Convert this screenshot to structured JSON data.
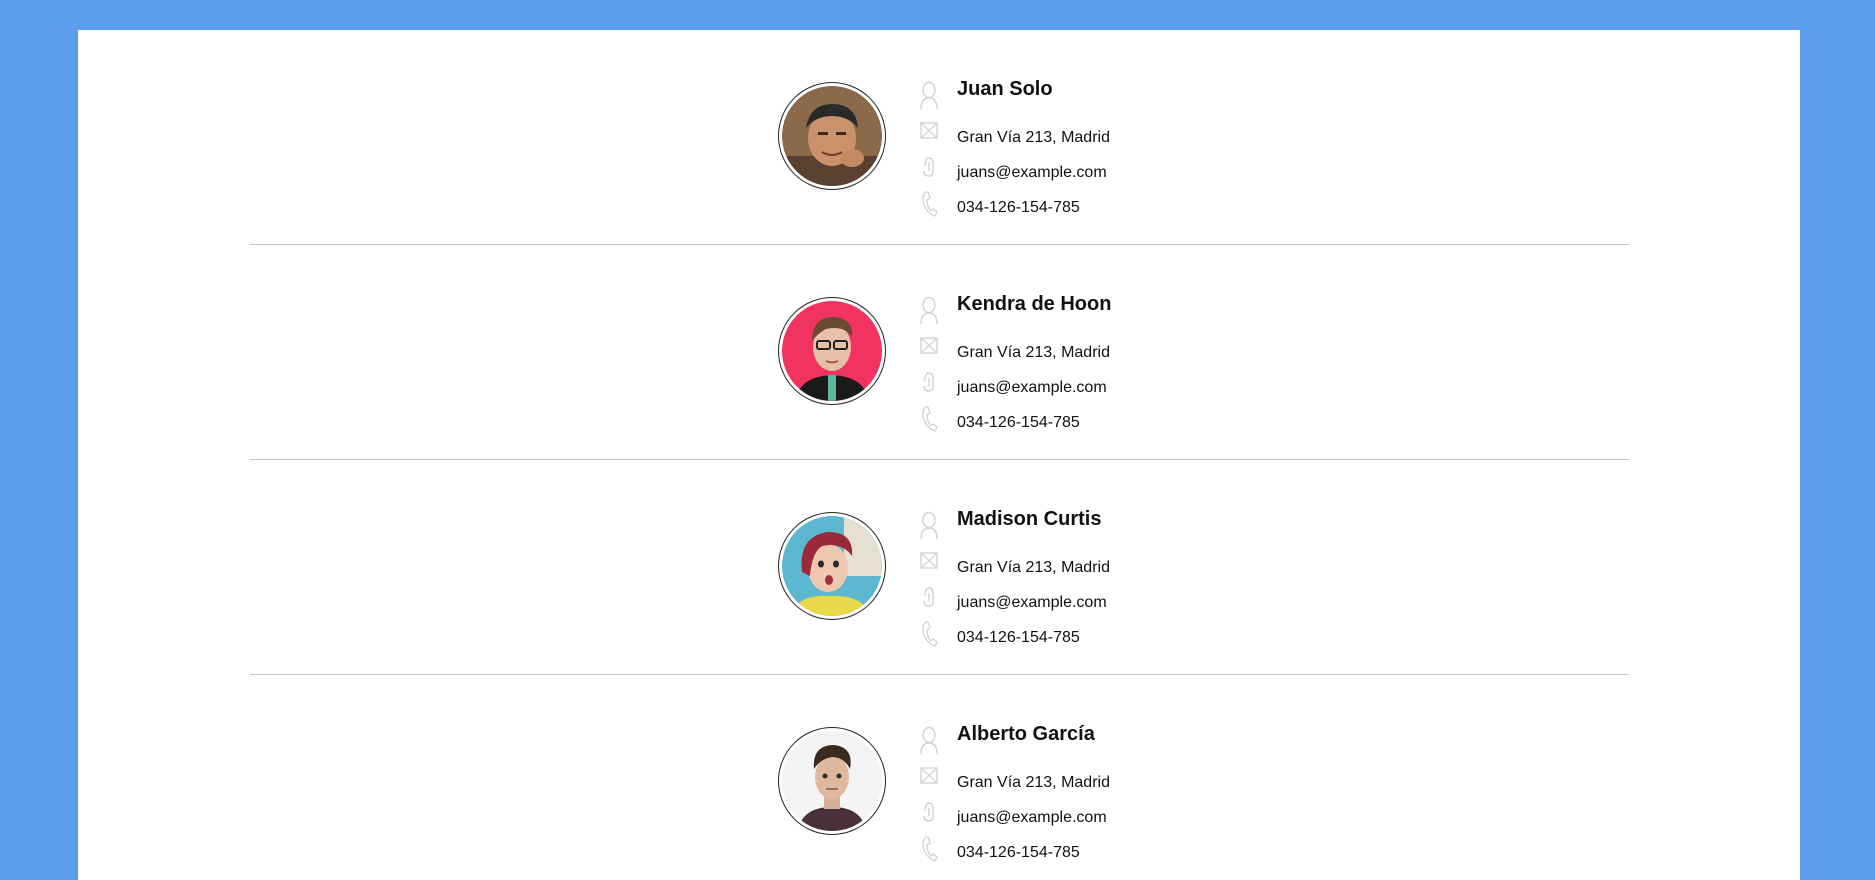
{
  "contacts": [
    {
      "name": "Juan Solo",
      "address": "Gran Vía 213, Madrid",
      "email": "juans@example.com",
      "phone": "034-126-154-785",
      "avatar": {
        "bg": "#8a6a4a",
        "skin": "#c9926a",
        "hair": "#2a2a2a",
        "shirt": "#5a4030"
      }
    },
    {
      "name": "Kendra de Hoon",
      "address": "Gran Vía 213, Madrid",
      "email": "juans@example.com",
      "phone": "034-126-154-785",
      "avatar": {
        "bg": "#f0335f",
        "skin": "#e8c0a8",
        "hair": "#6a4a30",
        "shirt": "#1a1a1a"
      }
    },
    {
      "name": "Madison Curtis",
      "address": "Gran Vía 213, Madrid",
      "email": "juans@example.com",
      "phone": "034-126-154-785",
      "avatar": {
        "bg": "#5cb8d0",
        "skin": "#f0c8b0",
        "hair": "#9a2a3a",
        "shirt": "#e8d84a"
      }
    },
    {
      "name": "Alberto García",
      "address": "Gran Vía 213, Madrid",
      "email": "juans@example.com",
      "phone": "034-126-154-785",
      "avatar": {
        "bg": "#f4f4f4",
        "skin": "#e0b8a0",
        "hair": "#3a2a20",
        "shirt": "#4a3038"
      }
    }
  ],
  "icons": [
    "user-icon",
    "envelope-icon",
    "at-icon",
    "phone-icon"
  ],
  "colors": {
    "background": "#5c9ded",
    "sheet": "#ffffff",
    "divider": "#c8c8c8",
    "icon": "#d2d2d2"
  }
}
